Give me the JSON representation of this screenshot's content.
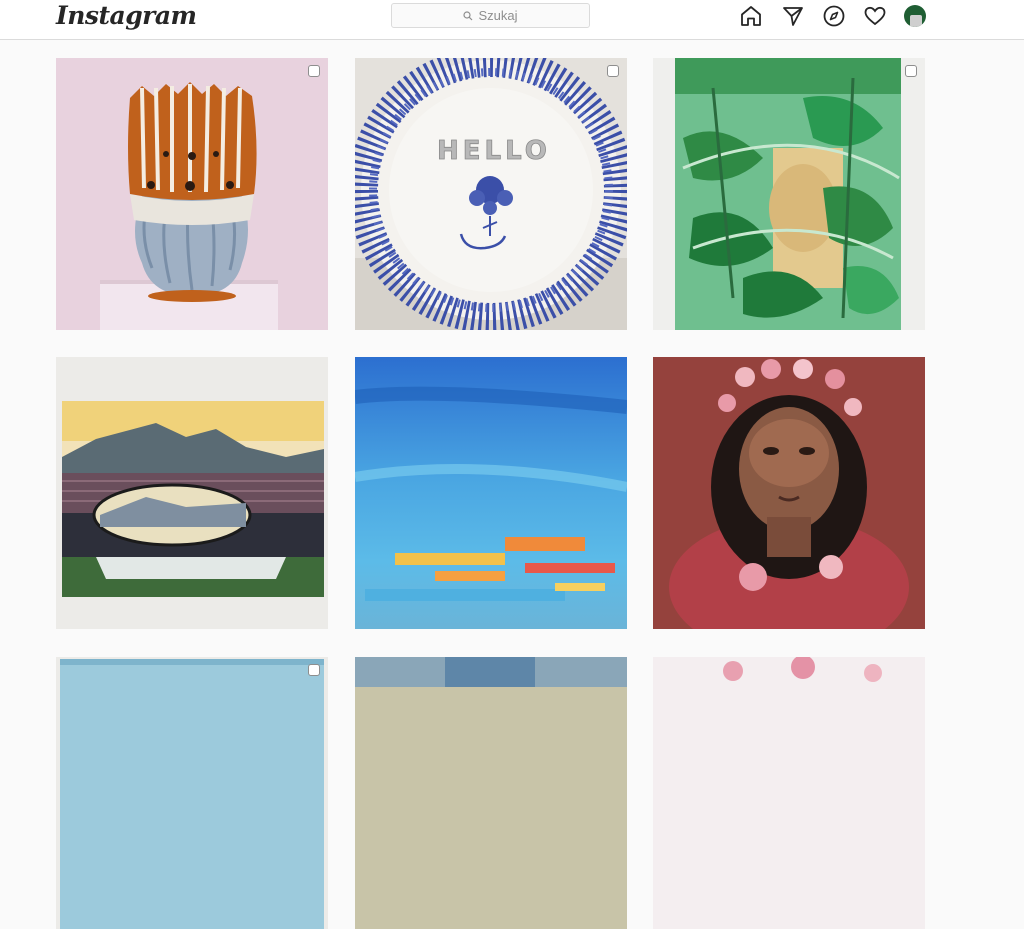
{
  "header": {
    "logo": "Instagram",
    "search_placeholder": "Szukaj",
    "icons": [
      "home-icon",
      "direct-icon",
      "explore-icon",
      "activity-heart-icon",
      "profile-avatar"
    ]
  },
  "grid": {
    "posts": [
      {
        "subject": "ceramic-vase-image",
        "has_select_box": true
      },
      {
        "subject": "hello-plate-image",
        "has_select_box": true
      },
      {
        "subject": "leaves-painting-image",
        "has_select_box": true
      },
      {
        "subject": "mountain-landscape-image",
        "has_select_box": false
      },
      {
        "subject": "blue-abstract-painting-image",
        "has_select_box": false
      },
      {
        "subject": "girl-portrait-painting-image",
        "has_select_box": false
      },
      {
        "subject": "partial-landscape-image",
        "has_select_box": true
      },
      {
        "subject": "partial-blue-image",
        "has_select_box": false
      },
      {
        "subject": "partial-pink-image",
        "has_select_box": false
      }
    ],
    "plate_text": "HELLO"
  },
  "colors": {
    "background": "#fafafa",
    "header_bg": "#ffffff",
    "border": "#dbdbdb",
    "text_muted": "#8e8e8e",
    "icon": "#262626"
  }
}
